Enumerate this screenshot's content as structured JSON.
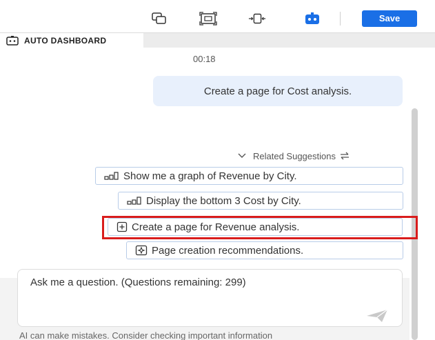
{
  "toolbar": {
    "save_label": "Save",
    "icons": [
      "copy-layers-icon",
      "fit-screen-icon",
      "collapse-arrows-icon",
      "ai-robot-icon"
    ],
    "accent": "#1a6fe6"
  },
  "tab": {
    "label": "AUTO DASHBOARD",
    "icon": "dashboard-robot-icon"
  },
  "chat": {
    "timestamp": "00:18",
    "user_message": "Create a page for Cost analysis.",
    "related_label": "Related Suggestions",
    "suggestions": [
      {
        "icon": "bar-chart-icon",
        "text": "Show me a graph of Revenue by City."
      },
      {
        "icon": "bar-chart-icon",
        "text": "Display the bottom 3 Cost by City."
      },
      {
        "icon": "add-page-icon",
        "text": "Create a page for Revenue analysis.",
        "highlighted": true
      },
      {
        "icon": "page-sparkle-icon",
        "text": "Page creation recommendations."
      }
    ],
    "highlight_color": "#d91c1c"
  },
  "composer": {
    "placeholder": "Ask me a question. (Questions remaining: 299)"
  },
  "disclaimer": "AI can make mistakes. Consider checking important information"
}
